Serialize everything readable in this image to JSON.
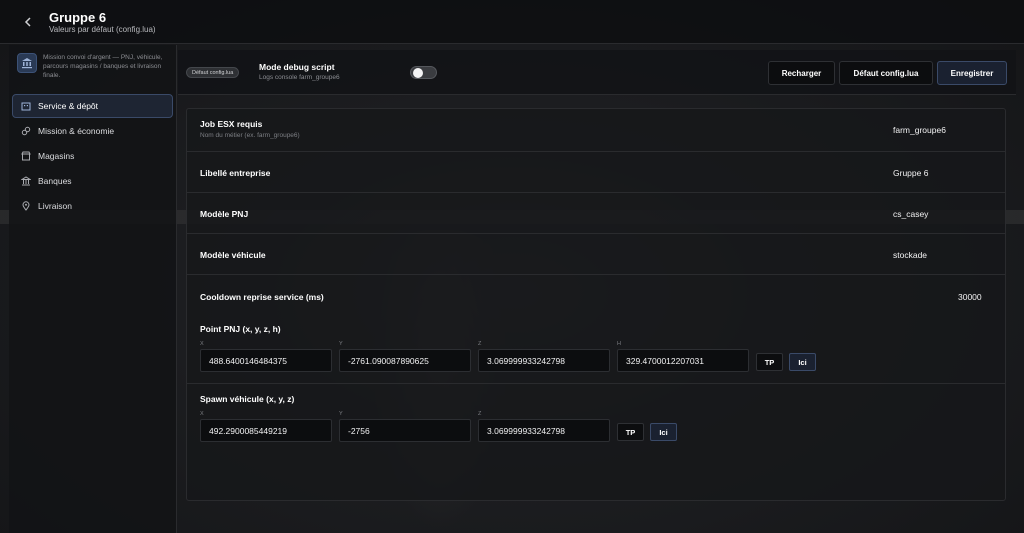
{
  "header": {
    "title": "Gruppe 6",
    "subtitle": "Valeurs par défaut (config.lua)"
  },
  "sidebar": {
    "description": "Mission convoi d'argent — PNJ, véhicule, parcours magasins / banques et livraison finale.",
    "items": [
      {
        "label": "Service & dépôt",
        "icon": "building-icon",
        "active": true
      },
      {
        "label": "Mission & économie",
        "icon": "link-icon",
        "active": false
      },
      {
        "label": "Magasins",
        "icon": "store-icon",
        "active": false
      },
      {
        "label": "Banques",
        "icon": "bank-icon",
        "active": false
      },
      {
        "label": "Livraison",
        "icon": "location-pin-icon",
        "active": false
      }
    ]
  },
  "toolbar": {
    "chip": "Défaut config.lua",
    "debug_title": "Mode debug script",
    "debug_sub": "Logs console farm_groupe6",
    "debug_enabled": false,
    "reload_label": "Recharger",
    "default_label": "Défaut config.lua",
    "save_label": "Enregistrer"
  },
  "form": {
    "job": {
      "label": "Job ESX requis",
      "hint": "Nom du métier (ex. farm_groupe6)",
      "value": "farm_groupe6"
    },
    "company": {
      "label": "Libellé entreprise",
      "value": "Gruppe 6"
    },
    "npc_model": {
      "label": "Modèle PNJ",
      "value": "cs_casey"
    },
    "vehicle_model": {
      "label": "Modèle véhicule",
      "value": "stockade"
    },
    "cooldown": {
      "label": "Cooldown reprise service (ms)",
      "value": "30000"
    },
    "npc_point": {
      "label": "Point PNJ (x, y, z, h)",
      "x_label": "X",
      "y_label": "Y",
      "z_label": "Z",
      "h_label": "H",
      "x": "488.6400146484375",
      "y": "-2761.090087890625",
      "z": "3.069999933242798",
      "h": "329.4700012207031",
      "tp_label": "TP",
      "here_label": "Ici"
    },
    "vehicle_spawn": {
      "label": "Spawn véhicule (x, y, z)",
      "x_label": "X",
      "y_label": "Y",
      "z_label": "Z",
      "x": "492.2900085449219",
      "y": "-2756",
      "z": "3.069999933242798",
      "tp_label": "TP",
      "here_label": "Ici"
    }
  },
  "colors": {
    "accent": "#3a4a68",
    "background": "#141517"
  }
}
